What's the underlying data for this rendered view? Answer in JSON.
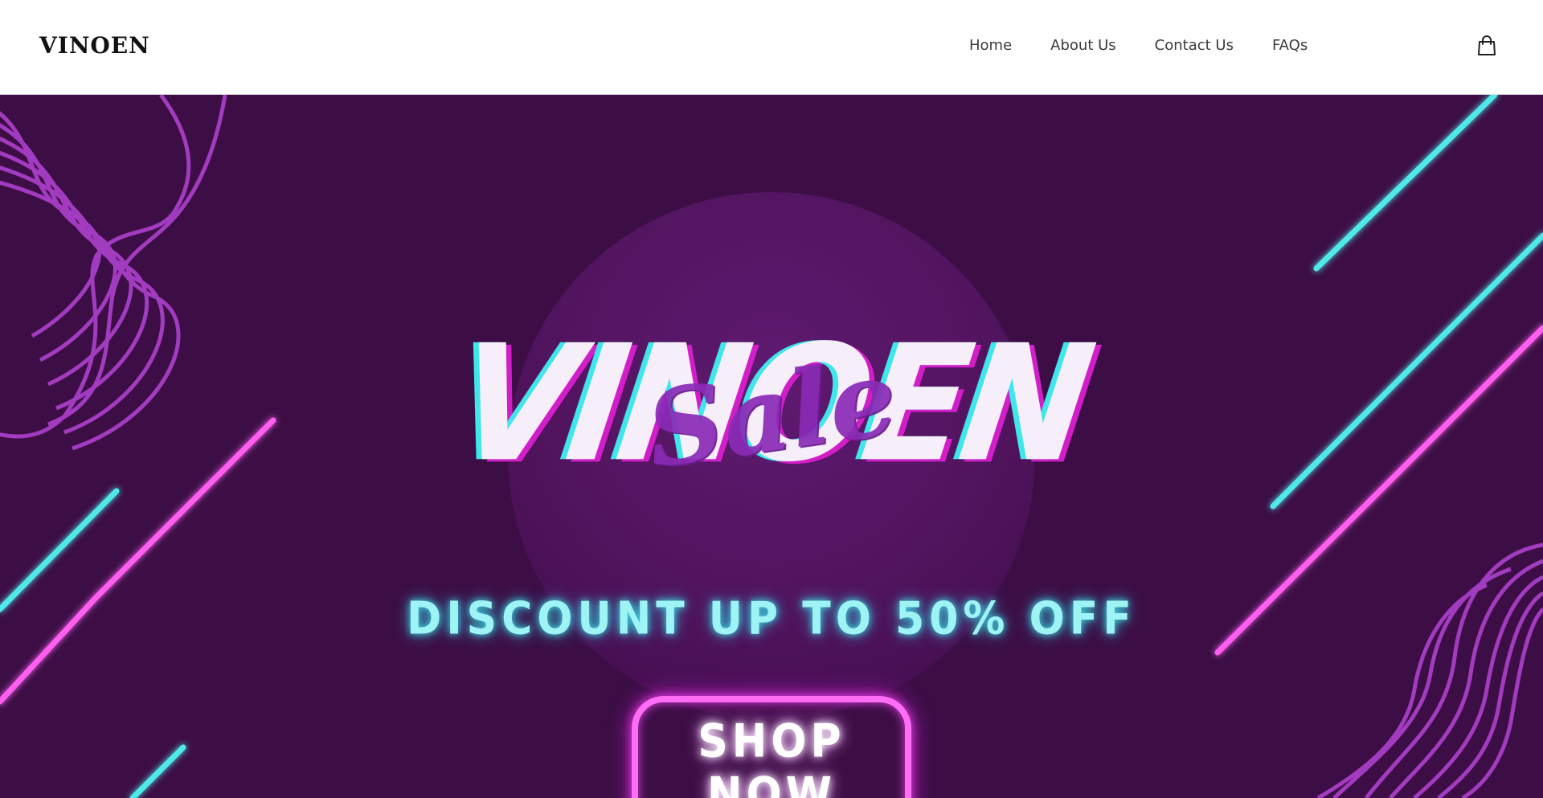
{
  "header": {
    "logo": "VINOEN",
    "nav": {
      "home": "Home",
      "about": "About Us",
      "contact": "Contact Us",
      "faqs": "FAQs"
    },
    "cart_icon": "shopping-bag-icon"
  },
  "hero": {
    "brand_title": "VINOEN",
    "script_title": "Sale",
    "discount_text": "DISCOUNT UP TO 50% OFF",
    "cta_label": "SHOP NOW",
    "colors": {
      "background": "#3c0e45",
      "circle": "#5e1a70",
      "neon_cyan": "#3fe6ea",
      "neon_pink": "#e23ce0",
      "wave_purple": "#a23bbf"
    }
  }
}
